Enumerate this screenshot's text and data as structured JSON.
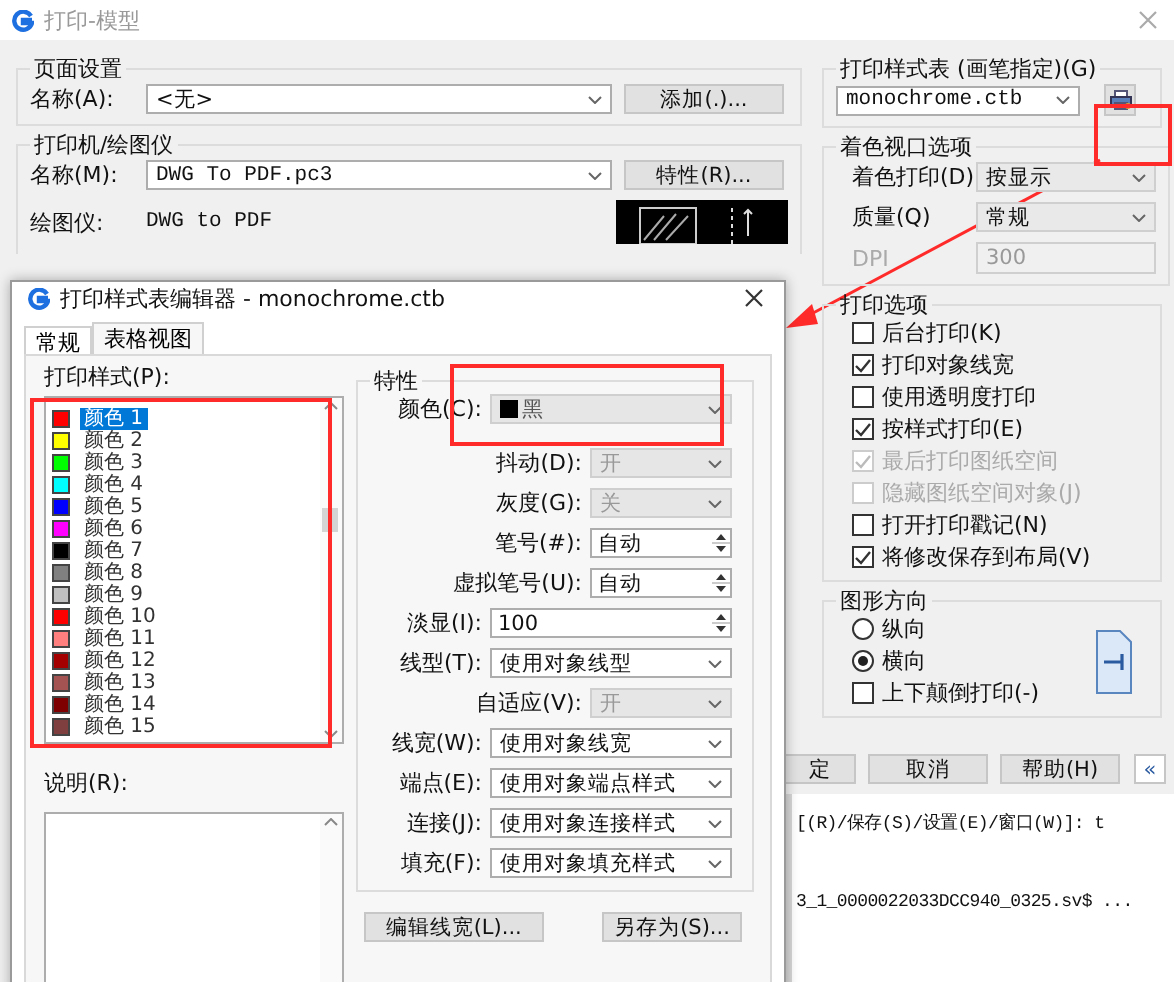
{
  "print_dialog": {
    "title": "打印-模型",
    "page_setup": {
      "heading": "页面设置",
      "name_label": "名称(A):",
      "name_value": "<无>",
      "add_button": "添加(.)..."
    },
    "printer": {
      "heading": "打印机/绘图仪",
      "name_label": "名称(M):",
      "name_value": "DWG To PDF.pc3",
      "properties_button": "特性(R)...",
      "plotter_label": "绘图仪:",
      "plotter_value": "DWG to PDF"
    },
    "plot_style_table": {
      "heading": "打印样式表 (画笔指定)(G)",
      "value": "monochrome.ctb"
    },
    "shaded_viewport": {
      "heading": "着色视口选项",
      "fields": [
        {
          "label": "着色打印(D)",
          "value": "按显示",
          "disabled": false
        },
        {
          "label": "质量(Q)",
          "value": "常规",
          "disabled": false
        },
        {
          "label": "DPI",
          "value": "300",
          "disabled": true
        }
      ]
    },
    "plot_options": {
      "heading": "打印选项",
      "options": [
        {
          "label": "后台打印(K)",
          "checked": false,
          "disabled": false
        },
        {
          "label": "打印对象线宽",
          "checked": true,
          "disabled": false
        },
        {
          "label": "使用透明度打印",
          "checked": false,
          "disabled": false
        },
        {
          "label": "按样式打印(E)",
          "checked": true,
          "disabled": false
        },
        {
          "label": "最后打印图纸空间",
          "checked": true,
          "disabled": true
        },
        {
          "label": "隐藏图纸空间对象(J)",
          "checked": false,
          "disabled": true
        },
        {
          "label": "打开打印戳记(N)",
          "checked": false,
          "disabled": false
        },
        {
          "label": "将修改保存到布局(V)",
          "checked": true,
          "disabled": false
        }
      ]
    },
    "orientation": {
      "heading": "图形方向",
      "options": [
        {
          "label": "纵向",
          "selected": false
        },
        {
          "label": "横向",
          "selected": true
        }
      ],
      "upside_down": {
        "label": "上下颠倒打印(-)",
        "checked": false
      }
    },
    "buttons": [
      "定",
      "取消",
      "帮助(H)",
      "«"
    ],
    "command_lines": [
      "[(R)/保存(S)/设置(E)/窗口(W)]: t",
      "3_1_0000022033DCC940_0325.sv$ ..."
    ]
  },
  "editor_dialog": {
    "title": "打印样式表编辑器 - monochrome.ctb",
    "tabs": [
      {
        "label": "常规",
        "selected": false
      },
      {
        "label": "表格视图",
        "selected": true
      }
    ],
    "styles_label": "打印样式(P):",
    "styles": [
      {
        "label": "颜色 1",
        "color": "#ff0000",
        "selected": true
      },
      {
        "label": "颜色 2",
        "color": "#ffff00",
        "selected": false
      },
      {
        "label": "颜色 3",
        "color": "#00ff00",
        "selected": false
      },
      {
        "label": "颜色 4",
        "color": "#00ffff",
        "selected": false
      },
      {
        "label": "颜色 5",
        "color": "#0000ff",
        "selected": false
      },
      {
        "label": "颜色 6",
        "color": "#ff00ff",
        "selected": false
      },
      {
        "label": "颜色 7",
        "color": "#000000",
        "selected": false
      },
      {
        "label": "颜色 8",
        "color": "#808080",
        "selected": false
      },
      {
        "label": "颜色 9",
        "color": "#c0c0c0",
        "selected": false
      },
      {
        "label": "颜色 10",
        "color": "#ff0000",
        "selected": false
      },
      {
        "label": "颜色 11",
        "color": "#ff7f7f",
        "selected": false
      },
      {
        "label": "颜色 12",
        "color": "#a50000",
        "selected": false
      },
      {
        "label": "颜色 13",
        "color": "#a55252",
        "selected": false
      },
      {
        "label": "颜色 14",
        "color": "#7f0000",
        "selected": false
      },
      {
        "label": "颜色 15",
        "color": "#7f3f3f",
        "selected": false
      }
    ],
    "description_label": "说明(R):",
    "properties": {
      "heading": "特性",
      "rows": [
        {
          "kind": "color",
          "label": "颜色(C):",
          "value": "黑",
          "disabled": true
        },
        {
          "kind": "short-select",
          "label": "抖动(D):",
          "value": "开",
          "disabled": true
        },
        {
          "kind": "short-select",
          "label": "灰度(G):",
          "value": "关",
          "disabled": true
        },
        {
          "kind": "short-spin",
          "label": "笔号(#):",
          "value": "自动",
          "disabled": false
        },
        {
          "kind": "short-spin",
          "label": "虚拟笔号(U):",
          "value": "自动",
          "disabled": false
        },
        {
          "kind": "spin",
          "label": "淡显(I):",
          "value": "100",
          "disabled": false
        },
        {
          "kind": "select",
          "label": "线型(T):",
          "value": "使用对象线型",
          "disabled": false
        },
        {
          "kind": "short-select",
          "label": "自适应(V):",
          "value": "开",
          "disabled": true
        },
        {
          "kind": "select",
          "label": "线宽(W):",
          "value": "使用对象线宽",
          "disabled": false
        },
        {
          "kind": "select",
          "label": "端点(E):",
          "value": "使用对象端点样式",
          "disabled": false
        },
        {
          "kind": "select",
          "label": "连接(J):",
          "value": "使用对象连接样式",
          "disabled": false
        },
        {
          "kind": "select",
          "label": "填充(F):",
          "value": "使用对象填充样式",
          "disabled": false
        }
      ]
    },
    "buttons": [
      "编辑线宽(L)...",
      "另存为(S)..."
    ]
  }
}
